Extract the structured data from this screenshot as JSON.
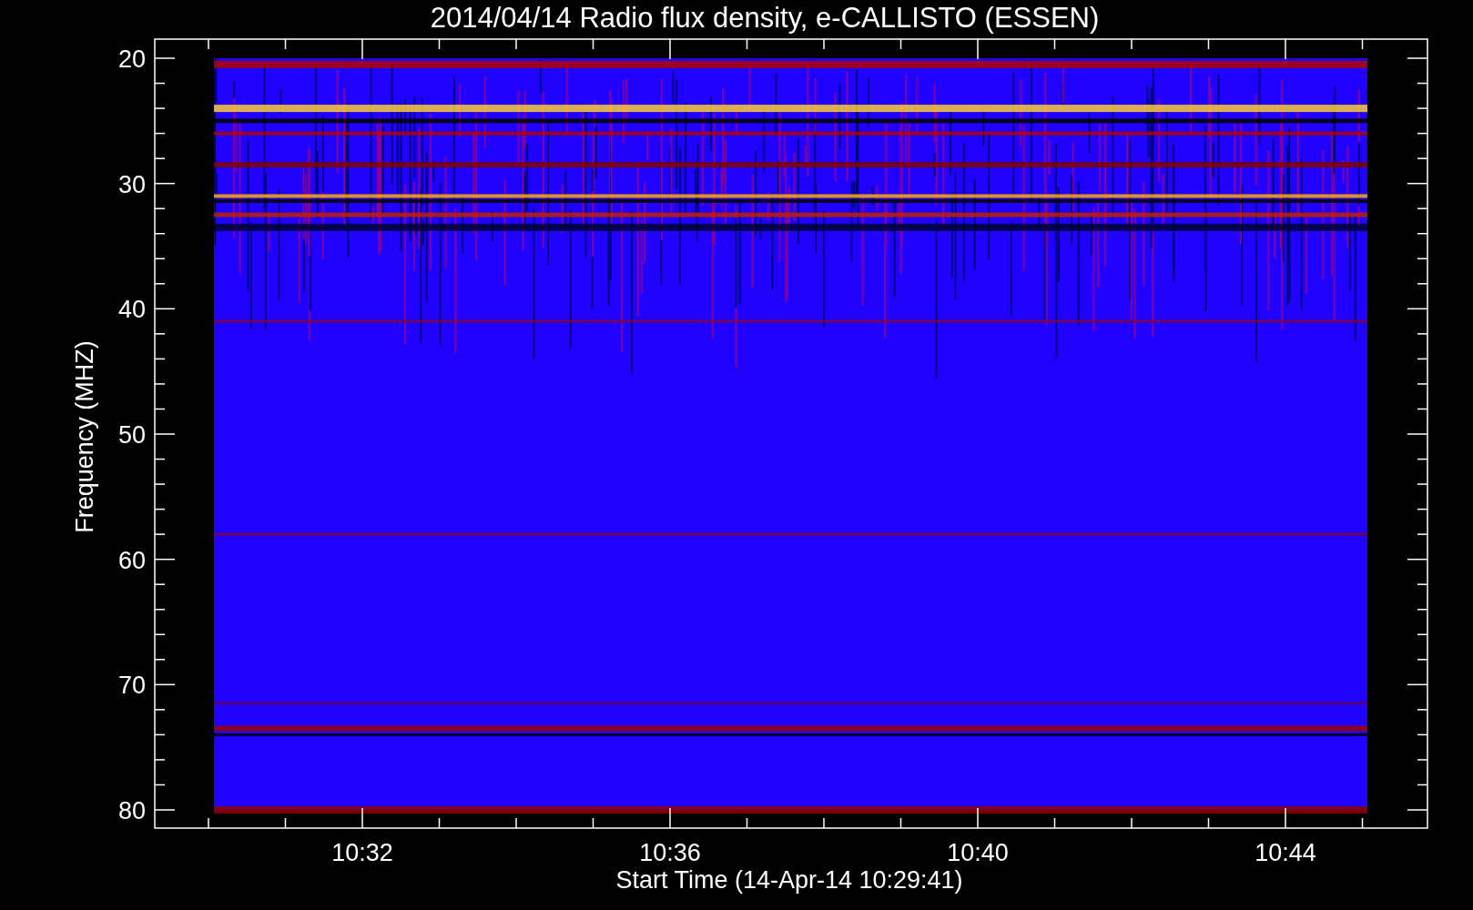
{
  "title": "2014/04/14  Radio flux density, e-CALLISTO (ESSEN)",
  "ylabel": "Frequency (MHZ)",
  "xlabel": "Start Time (14-Apr-14 10:29:41)",
  "yticks": [
    "20",
    "30",
    "40",
    "50",
    "60",
    "70",
    "80"
  ],
  "xticks": [
    "10:32",
    "10:36",
    "10:40",
    "10:44"
  ]
}
